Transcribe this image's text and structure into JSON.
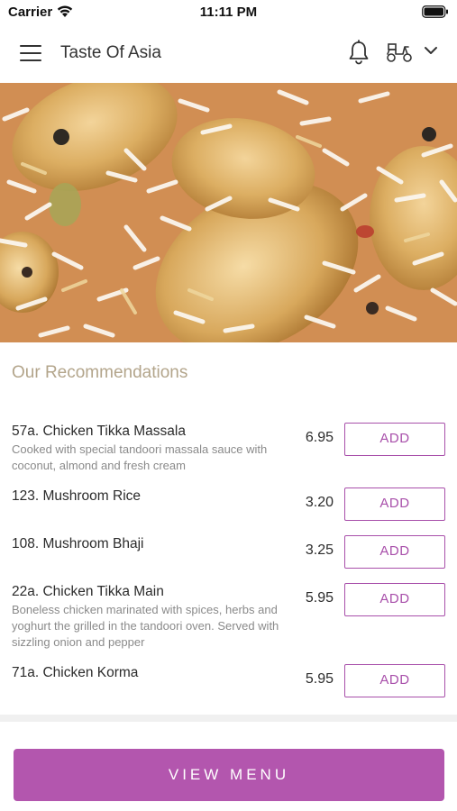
{
  "status_bar": {
    "carrier": "Carrier",
    "time": "11:11 PM"
  },
  "nav": {
    "title": "Taste Of Asia",
    "icons": [
      "menu-icon",
      "bell-icon",
      "scooter-icon",
      "chevron-down-icon"
    ]
  },
  "hero": {
    "description": "biryani-photo"
  },
  "recommendations": {
    "title": "Our Recommendations",
    "items": [
      {
        "name": "57a. Chicken Tikka Massala",
        "description": "Cooked with special tandoori massala sauce with coconut, almond and fresh cream",
        "price": "6.95",
        "button": "ADD"
      },
      {
        "name": "123. Mushroom Rice",
        "description": "",
        "price": "3.20",
        "button": "ADD"
      },
      {
        "name": "108. Mushroom Bhaji",
        "description": "",
        "price": "3.25",
        "button": "ADD"
      },
      {
        "name": "22a. Chicken Tikka Main",
        "description": "Boneless chicken marinated with spices, herbs and yoghurt the grilled in the tandoori oven. Served with sizzling onion and pepper",
        "price": "5.95",
        "button": "ADD"
      },
      {
        "name": "71a. Chicken Korma",
        "description": "",
        "price": "5.95",
        "button": "ADD"
      }
    ]
  },
  "footer": {
    "view_menu_label": "VIEW MENU"
  },
  "colors": {
    "accent": "#b356ae",
    "section_title": "#b3a58b"
  }
}
